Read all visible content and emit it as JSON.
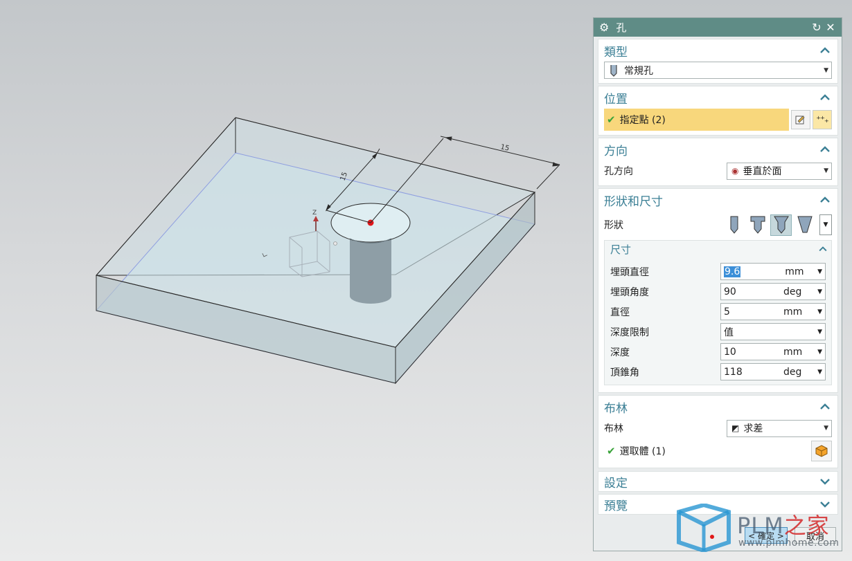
{
  "viewport": {
    "dim_labels": [
      "15",
      "15"
    ],
    "axis_label": "Z"
  },
  "dialog": {
    "title": "孔",
    "sections": {
      "type": {
        "title": "類型",
        "value": "常規孔"
      },
      "position": {
        "title": "位置",
        "select_label": "指定點 (2)"
      },
      "direction": {
        "title": "方向",
        "field_label": "孔方向",
        "value": "垂直於面"
      },
      "form": {
        "title": "形狀和尺寸",
        "shape_label": "形狀",
        "dims": {
          "title": "尺寸",
          "rows": [
            {
              "label": "埋頭直徑",
              "value": "9.6",
              "unit": "mm"
            },
            {
              "label": "埋頭角度",
              "value": "90",
              "unit": "deg"
            },
            {
              "label": "直徑",
              "value": "5",
              "unit": "mm"
            },
            {
              "label": "深度限制",
              "value": "值",
              "unit": ""
            },
            {
              "label": "深度",
              "value": "10",
              "unit": "mm"
            },
            {
              "label": "頂錐角",
              "value": "118",
              "unit": "deg"
            }
          ]
        }
      },
      "boolean": {
        "title": "布林",
        "field_label": "布林",
        "value": "求差",
        "select_label": "選取體 (1)"
      },
      "settings": {
        "title": "設定"
      },
      "preview": {
        "title": "預覽"
      }
    },
    "ok_label": "< 確定 >",
    "cancel_label": "取消"
  },
  "watermark": {
    "brand": "PLM",
    "brand_zh": "之家",
    "url": "www.plmhome.com"
  },
  "colors": {
    "title_bar": "#5f8c86",
    "section_title": "#3b7f95",
    "selection_highlight": "#f8d77c",
    "check": "#3aa33a"
  }
}
